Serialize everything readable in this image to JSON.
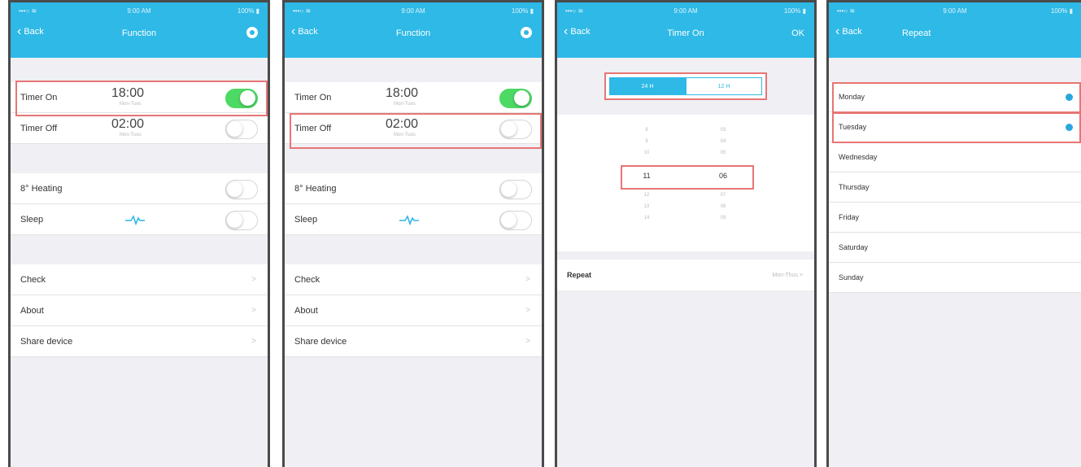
{
  "status": {
    "signal": "•••○ ≋",
    "time": "9:00 AM",
    "battery": "100% ▮"
  },
  "function_screen": {
    "back_label": "Back",
    "title": "Function",
    "timer_on": {
      "label": "Timer On",
      "time": "18:00",
      "sub": "Mon-Tues",
      "enabled": true
    },
    "timer_off": {
      "label": "Timer Off",
      "time": "02:00",
      "sub": "Mon-Tues",
      "enabled": false
    },
    "heating": {
      "label": "8° Heating",
      "enabled": false
    },
    "sleep": {
      "label": "Sleep",
      "icon": "sleep-wave-icon",
      "enabled": false
    },
    "menu": [
      {
        "label": "Check"
      },
      {
        "label": "About"
      },
      {
        "label": "Share device"
      }
    ]
  },
  "timer_on_screen": {
    "back_label": "Back",
    "title": "Timer On",
    "ok_label": "OK",
    "format_24": "24 H",
    "format_12": "12 H",
    "hours": [
      "8",
      "9",
      "10",
      "11",
      "12",
      "13",
      "14"
    ],
    "minutes": [
      "03",
      "04",
      "05",
      "06",
      "07",
      "08",
      "09"
    ],
    "selected_hour": "11",
    "selected_minute": "06",
    "repeat_label": "Repeat",
    "repeat_value": "Mon-Thus",
    "repeat_chevron": ">"
  },
  "repeat_screen": {
    "back_label": "Back",
    "title": "Repeat",
    "days": [
      {
        "label": "Monday",
        "selected": true
      },
      {
        "label": "Tuesday",
        "selected": true
      },
      {
        "label": "Wednesday",
        "selected": false
      },
      {
        "label": "Thursday",
        "selected": false
      },
      {
        "label": "Friday",
        "selected": false
      },
      {
        "label": "Saturday",
        "selected": false
      },
      {
        "label": "Sunday",
        "selected": false
      }
    ]
  },
  "chevron": ">",
  "colors": {
    "nav": "#2eb9e6",
    "toggle_on": "#4cd964",
    "highlight": "#e87575",
    "dot": "#2ba7dc"
  }
}
